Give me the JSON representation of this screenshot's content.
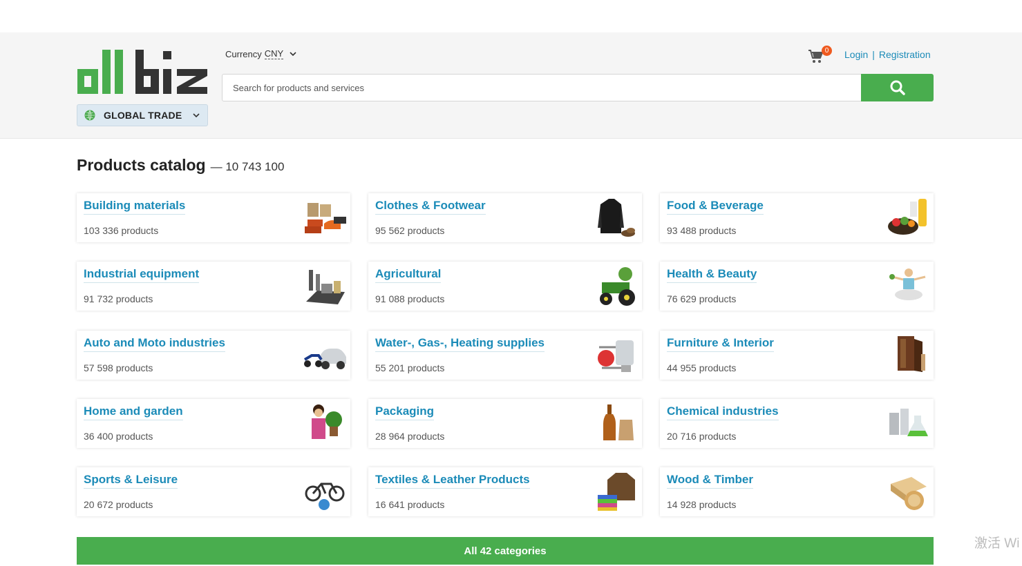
{
  "header": {
    "logo_text": "allbiz",
    "region_label": "GLOBAL TRADE",
    "currency_label": "Currency",
    "currency_code": "CNY",
    "cart_count": "0",
    "login": "Login",
    "separator": "|",
    "registration": "Registration",
    "search_placeholder": "Search for products and services"
  },
  "catalog": {
    "title": "Products catalog",
    "count": "— 10 743 100",
    "categories": [
      {
        "name": "Building materials",
        "count": "103 336 products",
        "icon": "bricks-icon"
      },
      {
        "name": "Clothes & Footwear",
        "count": "95 562 products",
        "icon": "shirt-icon"
      },
      {
        "name": "Food & Beverage",
        "count": "93 488 products",
        "icon": "food-icon"
      },
      {
        "name": "Industrial equipment",
        "count": "91 732 products",
        "icon": "factory-icon"
      },
      {
        "name": "Agricultural",
        "count": "91 088 products",
        "icon": "tractor-icon"
      },
      {
        "name": "Health & Beauty",
        "count": "76 629 products",
        "icon": "yoga-icon"
      },
      {
        "name": "Auto and Moto industries",
        "count": "57 598 products",
        "icon": "car-icon"
      },
      {
        "name": "Water-, Gas-, Heating supplies",
        "count": "55 201 products",
        "icon": "boiler-icon"
      },
      {
        "name": "Furniture & Interior",
        "count": "44 955 products",
        "icon": "wardrobe-icon"
      },
      {
        "name": "Home and garden",
        "count": "36 400 products",
        "icon": "plant-icon"
      },
      {
        "name": "Packaging",
        "count": "28 964 products",
        "icon": "bottle-icon"
      },
      {
        "name": "Chemical industries",
        "count": "20 716 products",
        "icon": "flask-icon"
      },
      {
        "name": "Sports & Leisure",
        "count": "20 672 products",
        "icon": "bicycle-icon"
      },
      {
        "name": "Textiles & Leather Products",
        "count": "16 641 products",
        "icon": "jacket-icon"
      },
      {
        "name": "Wood & Timber",
        "count": "14 928 products",
        "icon": "wood-icon"
      }
    ],
    "all_button": "All 42 categories"
  },
  "overlay": {
    "watermark": "激活 Wi"
  },
  "colors": {
    "brand_green": "#49ad4e",
    "link_blue": "#1b8bb8",
    "badge_orange": "#ef5a1f"
  }
}
